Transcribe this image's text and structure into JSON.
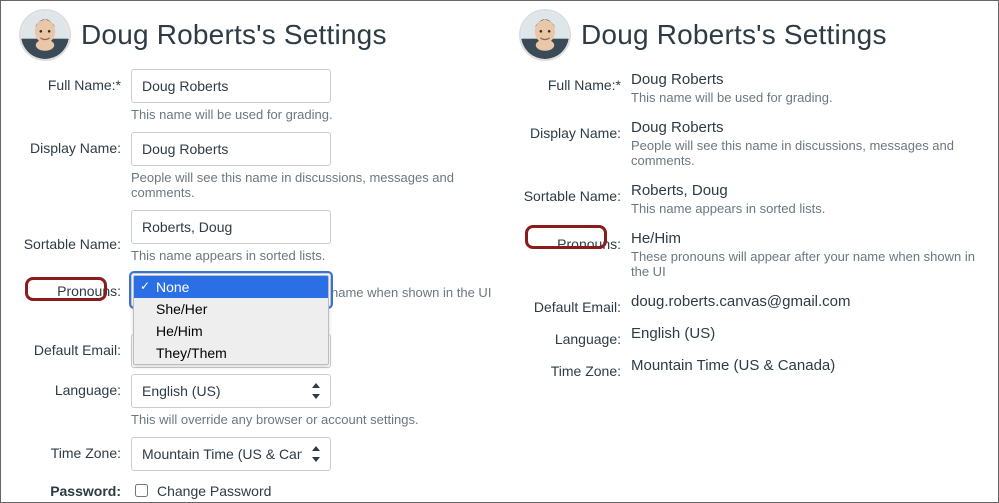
{
  "title": "Doug Roberts's Settings",
  "left": {
    "full_name": {
      "label": "Full Name:*",
      "value": "Doug Roberts",
      "hint": "This name will be used for grading."
    },
    "display_name": {
      "label": "Display Name:",
      "value": "Doug Roberts",
      "hint": "People will see this name in discussions, messages and comments."
    },
    "sortable": {
      "label": "Sortable Name:",
      "value": "Roberts, Doug",
      "hint": "This name appears in sorted lists."
    },
    "pronouns": {
      "label": "Pronouns:",
      "options": [
        "None",
        "She/Her",
        "He/Him",
        "They/Them"
      ],
      "selected": "None",
      "hint_tail": "name when shown in the UI"
    },
    "email": {
      "label": "Default Email:"
    },
    "language": {
      "label": "Language:",
      "value": "English (US)",
      "hint": "This will override any browser or account settings."
    },
    "timezone": {
      "label": "Time Zone:",
      "value": "Mountain Time (US & Canada) ("
    },
    "password": {
      "label": "Password:",
      "checkbox_label": "Change Password"
    }
  },
  "right": {
    "full_name": {
      "label": "Full Name:*",
      "value": "Doug Roberts",
      "hint": "This name will be used for grading."
    },
    "display_name": {
      "label": "Display Name:",
      "value": "Doug Roberts",
      "hint": "People will see this name in discussions, messages and comments."
    },
    "sortable": {
      "label": "Sortable Name:",
      "value": "Roberts, Doug",
      "hint": "This name appears in sorted lists."
    },
    "pronouns": {
      "label": "Pronouns:",
      "value": "He/Him",
      "hint": "These pronouns will appear after your name when shown in the UI"
    },
    "email": {
      "label": "Default Email:",
      "value": "doug.roberts.canvas@gmail.com"
    },
    "language": {
      "label": "Language:",
      "value": "English (US)"
    },
    "timezone": {
      "label": "Time Zone:",
      "value": "Mountain Time (US & Canada)"
    }
  }
}
